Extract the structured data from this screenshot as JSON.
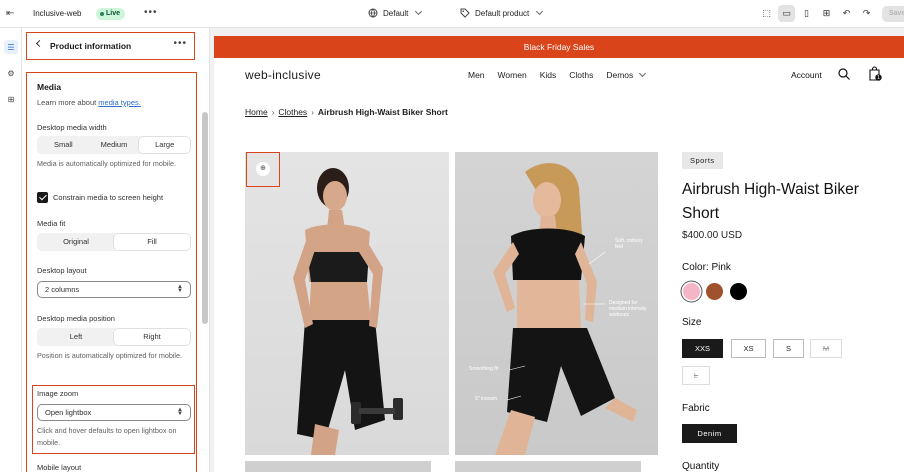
{
  "topbar": {
    "store_name": "Inclusive-web",
    "status": "Live",
    "theme_label": "Default",
    "template_label": "Default product",
    "save_label": "Save"
  },
  "panel": {
    "title": "Product information",
    "section_title": "Media",
    "learn_prefix": "Learn more about ",
    "learn_link": "media types.",
    "desktop_media_width": {
      "label": "Desktop media width",
      "options": [
        "Small",
        "Medium",
        "Large"
      ],
      "selected": "Large"
    },
    "media_optimized_help": "Media is automatically optimized for mobile.",
    "constrain_label": "Constrain media to screen height",
    "constrain_checked": true,
    "media_fit": {
      "label": "Media fit",
      "options": [
        "Original",
        "Fill"
      ],
      "selected": "Fill"
    },
    "desktop_layout": {
      "label": "Desktop layout",
      "value": "2 columns"
    },
    "desktop_media_position": {
      "label": "Desktop media position",
      "options": [
        "Left",
        "Right"
      ],
      "selected": "Right"
    },
    "position_help": "Position is automatically optimized for mobile.",
    "image_zoom": {
      "label": "Image zoom",
      "value": "Open lightbox"
    },
    "zoom_help": "Click and hover defaults to open lightbox on mobile.",
    "mobile_layout_label": "Mobile layout"
  },
  "preview": {
    "banner": "Black Friday Sales",
    "logo": "web-inclusive",
    "nav": [
      "Men",
      "Women",
      "Kids",
      "Cloths",
      "Demos"
    ],
    "account": "Account",
    "cart_count": "1",
    "breadcrumb": {
      "home": "Home",
      "category": "Clothes",
      "current": "Airbrush High-Waist Biker Short"
    },
    "image_notes": {
      "soft": "Soft, cottony feel",
      "designed": "Designed for medium intensity workouts",
      "smoothing": "Smoothing fit",
      "inseam": "5\" inseam"
    },
    "product": {
      "tag": "Sports",
      "title": "Airbrush High-Waist Biker Short",
      "price": "$400.00 USD",
      "color_label": "Color: Pink",
      "colors": [
        "#f4b6c5",
        "#a0522d",
        "#000000"
      ],
      "size_label": "Size",
      "sizes": [
        "XXS",
        "XS",
        "S",
        "M",
        "L"
      ],
      "selected_size": "XXS",
      "fabric_label": "Fabric",
      "fabric_value": "Denim",
      "quantity_label": "Quantity"
    }
  }
}
